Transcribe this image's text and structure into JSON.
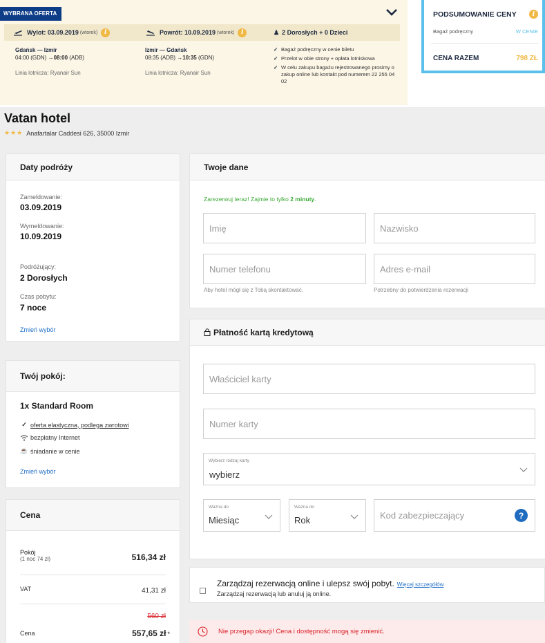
{
  "flight": {
    "badge": "WYBRANA OFERTA",
    "outbound_header": "Wylot: 03.09.2019",
    "outbound_day": "(wtorek)",
    "return_header": "Powrót: 10.09.2019",
    "return_day": "(wtorek)",
    "passengers": "2 Dorosłych + 0 Dzieci",
    "outbound_route": "Gdańsk — Izmir",
    "outbound_times_a": "04:00 (GDN) →",
    "outbound_times_b": "08:00",
    "outbound_times_c": "(ADB)",
    "outbound_airline": "Linia lotnicza: Ryanair Sun",
    "return_route": "Izmir — Gdańsk",
    "return_times_a": "08:35 (ADB) →",
    "return_times_b": "10:35",
    "return_times_c": "(GDN)",
    "return_airline": "Linia lotnicza: Ryanair Sun",
    "checks": [
      "Bagaż podręczny w cenie biletu",
      "Przelot w obie strony + opłata lotniskowa",
      "W celu zakupu bagażu rejestrowanego prosimy o zakup online lub kontakt pod numerem 22 255 04 02"
    ]
  },
  "summary": {
    "title": "PODSUMOWANIE CENY",
    "bag_label": "Bagaż podręczny",
    "bag_value": "W CENIE",
    "total_label": "CENA RAZEM",
    "total_value": "798 ZŁ"
  },
  "hotel": {
    "name": "Vatan hotel",
    "stars": "★★★",
    "address": "Anafartalar Caddesi 626, 35000 Izmir"
  },
  "trip": {
    "title": "Daty podróży",
    "checkin_label": "Zameldowanie:",
    "checkin_value": "03.09.2019",
    "checkout_label": "Wymeldowanie:",
    "checkout_value": "10.09.2019",
    "travelers_label": "Podróżujący:",
    "travelers_value": "2 Dorosłych",
    "stay_label": "Czas pobytu:",
    "stay_value": "7 noce",
    "change_link": "Zmień wybór"
  },
  "room": {
    "title": "Twój pokój:",
    "name": "1x Standard Room",
    "amenities": [
      "oferta elastyczna, podlega zwrotowi",
      "bezpłatny Internet",
      "śniadanie w cenie"
    ],
    "change_link": "Zmień wybór"
  },
  "price": {
    "title": "Cena",
    "room_label": "Pokój",
    "room_sub": "(1 noc 74 zł)",
    "room_value": "516,34 zł",
    "vat_label": "VAT",
    "vat_value": "41,31 zł",
    "old_price": "560 zł",
    "price_label": "Cena",
    "price_value": "557,65 zł",
    "price_mark": "*"
  },
  "your_data": {
    "title": "Twoje dane",
    "promo_text": "Zarezerwuj teraz! Zajmie to tylko ",
    "promo_bold": "2 minuty",
    "promo_end": ".",
    "first_name_placeholder": "Imię",
    "last_name_placeholder": "Nazwisko",
    "phone_placeholder": "Numer telefonu",
    "email_placeholder": "Adres e-mail",
    "phone_hint": "Aby hotel mógł się z Tobą skontaktować.",
    "email_hint": "Potrzebny do potwierdzenia rezerwacji"
  },
  "payment": {
    "title": "Płatność kartą kredytową",
    "holder_placeholder": "Właściciel karty",
    "number_placeholder": "Numer karty",
    "card_type_label": "Wybierz rodzaj karty",
    "card_type_value": "wybierz",
    "valid_label": "Ważna do",
    "month_value": "Miesiąc",
    "year_value": "Rok",
    "cvv_placeholder": "Kod zabezpieczający",
    "help_glyph": "?"
  },
  "manage": {
    "title": "Zarządzaj rezerwacją online i ulepsz swój pobyt.",
    "more_link": "Więcej szczegółów",
    "subtitle": "Zarządzaj rezerwacją lub anuluj ją online."
  },
  "alert": {
    "text": "Nie przegap okazji! Cena i dostępność mogą się zmienić."
  },
  "colors": {
    "navy": "#0e3d87",
    "accent_yellow": "#f0b844",
    "summary_border": "#5bc0eb",
    "link_blue": "#2171c7",
    "promo_green": "#3aa935",
    "alert_red": "#d9222a"
  }
}
